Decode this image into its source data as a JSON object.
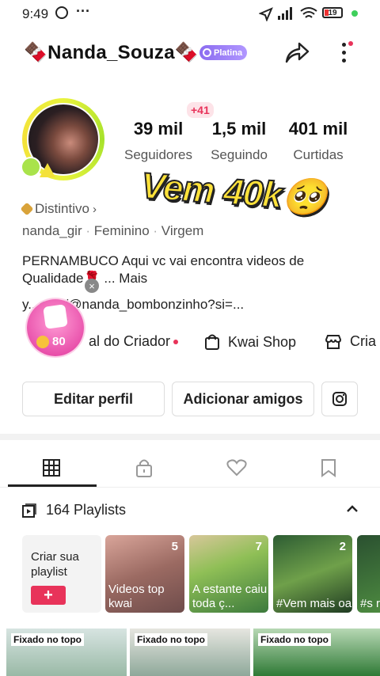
{
  "status_bar": {
    "time": "9:49",
    "battery": "19"
  },
  "profile": {
    "username": "🍫Nanda_Souza🍫",
    "badge": "Platina",
    "new_followers": "+41",
    "stats": [
      {
        "value": "39 mil",
        "label": "Seguidores"
      },
      {
        "value": "1,5 mil",
        "label": "Seguindo"
      },
      {
        "value": "401 mil",
        "label": "Curtidas"
      }
    ],
    "sticker_text": "Vem 40k🥺",
    "distinctive": "Distintivo",
    "handle": "nanda_gir",
    "gender": "Feminino",
    "sign": "Virgem",
    "bio_line1": "PERNAMBUCO Aqui vc vai encontra videos de",
    "bio_line2": "Qualidade🌹  ...  Mais",
    "link": "y...com/@nanda_bombonzinho?si=...",
    "coin_value": "80"
  },
  "shortcuts": [
    {
      "label": "al do Criador"
    },
    {
      "label": "Kwai Shop"
    },
    {
      "label": "Cria"
    }
  ],
  "buttons": {
    "edit": "Editar perfil",
    "add": "Adicionar amigos"
  },
  "playlists": {
    "header": "164 Playlists",
    "create_label": "Criar sua playlist",
    "items": [
      {
        "count": "5",
        "title": "Videos top kwai"
      },
      {
        "count": "7",
        "title": "A estante caiu toda ç..."
      },
      {
        "count": "2",
        "title": "#Vem mais oa"
      },
      {
        "count": "",
        "title": "#s rdo"
      }
    ]
  },
  "grid": {
    "pinned_label": "Fixado no topo"
  }
}
